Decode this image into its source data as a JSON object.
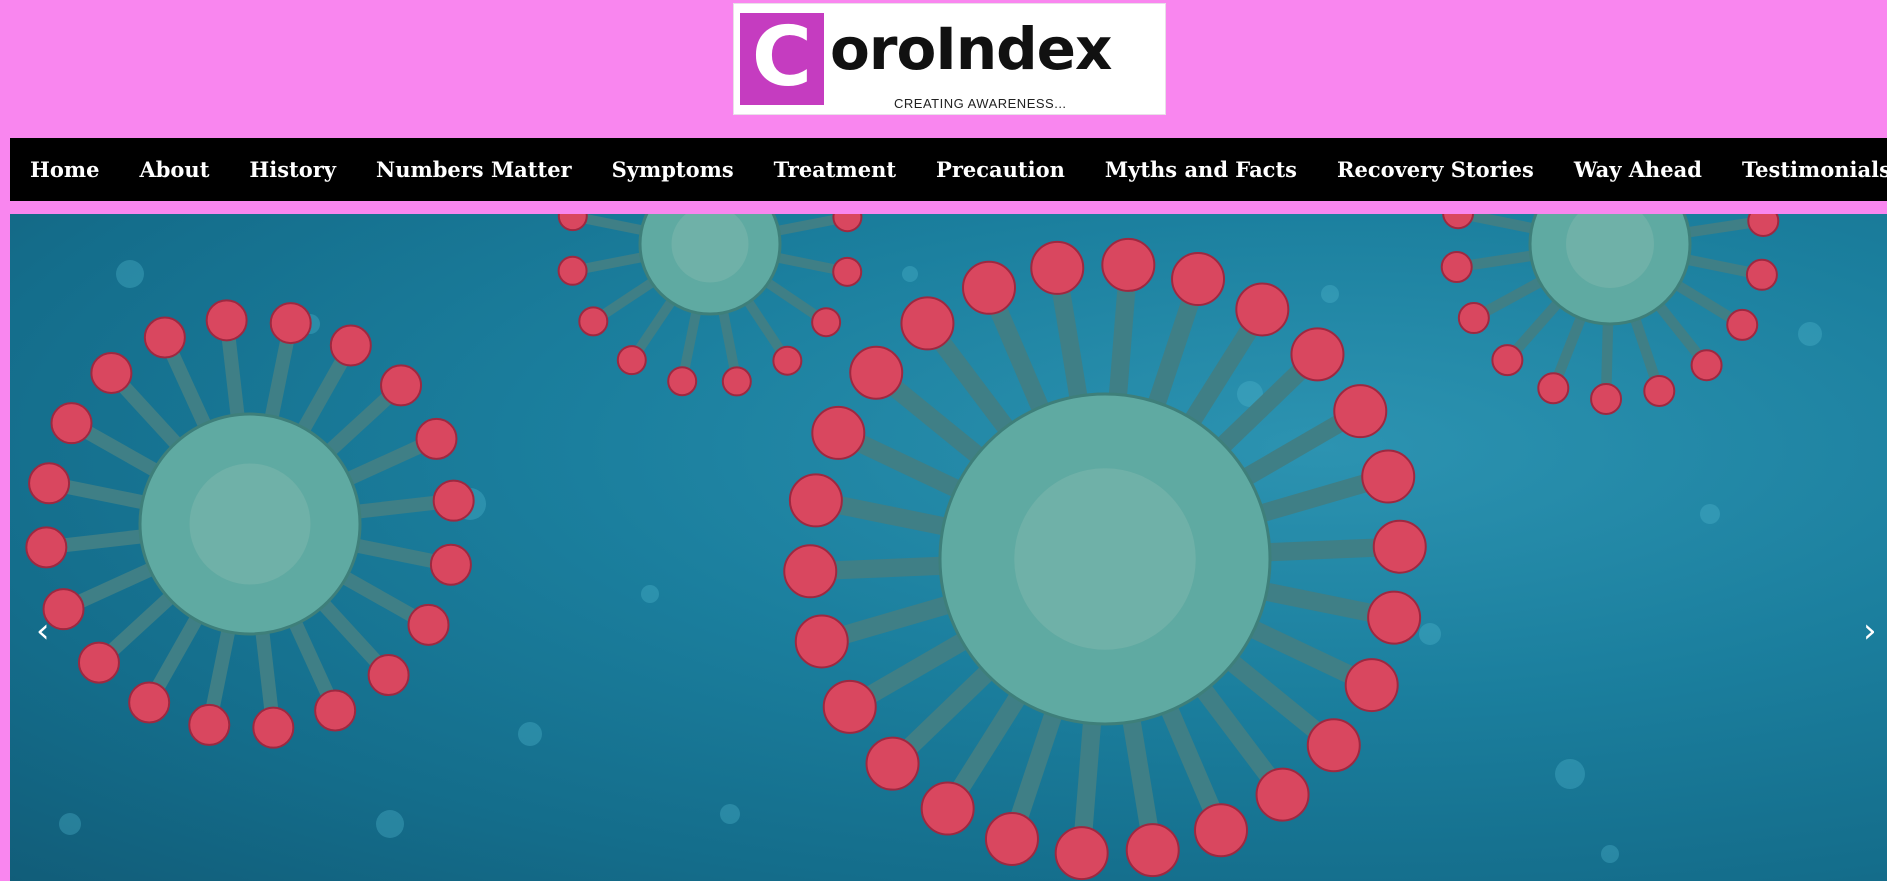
{
  "logo": {
    "mark_letter": "C",
    "name_rest": "oroIndex",
    "tagline": "CREATING AWARENESS..."
  },
  "nav": {
    "items": [
      "Home",
      "About",
      "History",
      "Numbers Matter",
      "Symptoms",
      "Treatment",
      "Precaution",
      "Myths and Facts",
      "Recovery Stories",
      "Way Ahead",
      "Testimonials"
    ]
  },
  "carousel": {
    "prev_label": "‹",
    "next_label": "›"
  },
  "colors": {
    "page_background": "#f986ef",
    "logo_mark": "#c53cc0",
    "navbar": "#000000",
    "nav_text": "#ffffff",
    "virus_body": "#5faaa2",
    "virus_spike": "#d9475f"
  },
  "icons": {
    "prev": "chevron-left-icon",
    "next": "chevron-right-icon"
  }
}
